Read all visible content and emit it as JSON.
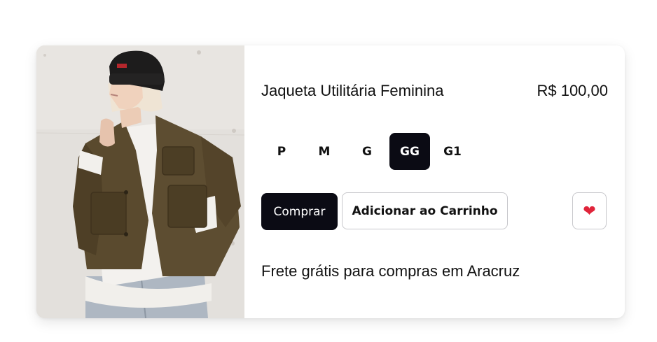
{
  "product": {
    "image_alt": "woman-in-olive-utility-jacket-photo",
    "title": "Jaqueta Utilitária Feminina",
    "price": "R$ 100,00",
    "sizes": [
      {
        "label": "P",
        "selected": false
      },
      {
        "label": "M",
        "selected": false
      },
      {
        "label": "G",
        "selected": false
      },
      {
        "label": "GG",
        "selected": true
      },
      {
        "label": "G1",
        "selected": false
      }
    ],
    "buy_label": "Comprar",
    "add_to_cart_label": "Adicionar ao Carrinho",
    "favorite_icon": "heart-icon",
    "shipping_text": "Frete grátis para compras em Aracruz"
  },
  "colors": {
    "dark_button": "#0b0b14",
    "heart": "#e0243a",
    "border": "#c8c8cc"
  }
}
